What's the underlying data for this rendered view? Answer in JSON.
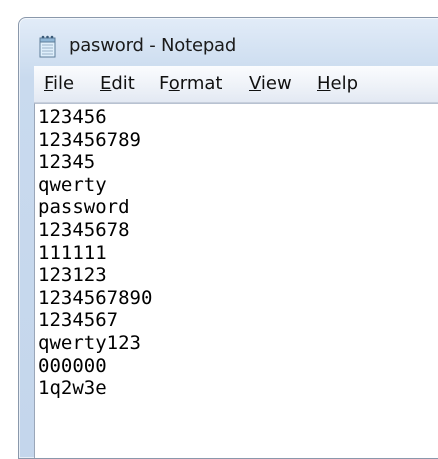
{
  "window": {
    "title": "pasword - Notepad",
    "app_icon": "notepad-icon"
  },
  "menubar": {
    "items": [
      {
        "pre": "",
        "mnemonic": "F",
        "post": "ile"
      },
      {
        "pre": "",
        "mnemonic": "E",
        "post": "dit"
      },
      {
        "pre": "F",
        "mnemonic": "o",
        "post": "rmat"
      },
      {
        "pre": "",
        "mnemonic": "V",
        "post": "iew"
      },
      {
        "pre": "",
        "mnemonic": "H",
        "post": "elp"
      }
    ]
  },
  "editor": {
    "lines": [
      "123456",
      "123456789",
      "12345",
      "qwerty",
      "password",
      "12345678",
      "111111",
      "123123",
      "1234567890",
      "1234567",
      "qwerty123",
      "000000",
      "1q2w3e"
    ]
  }
}
